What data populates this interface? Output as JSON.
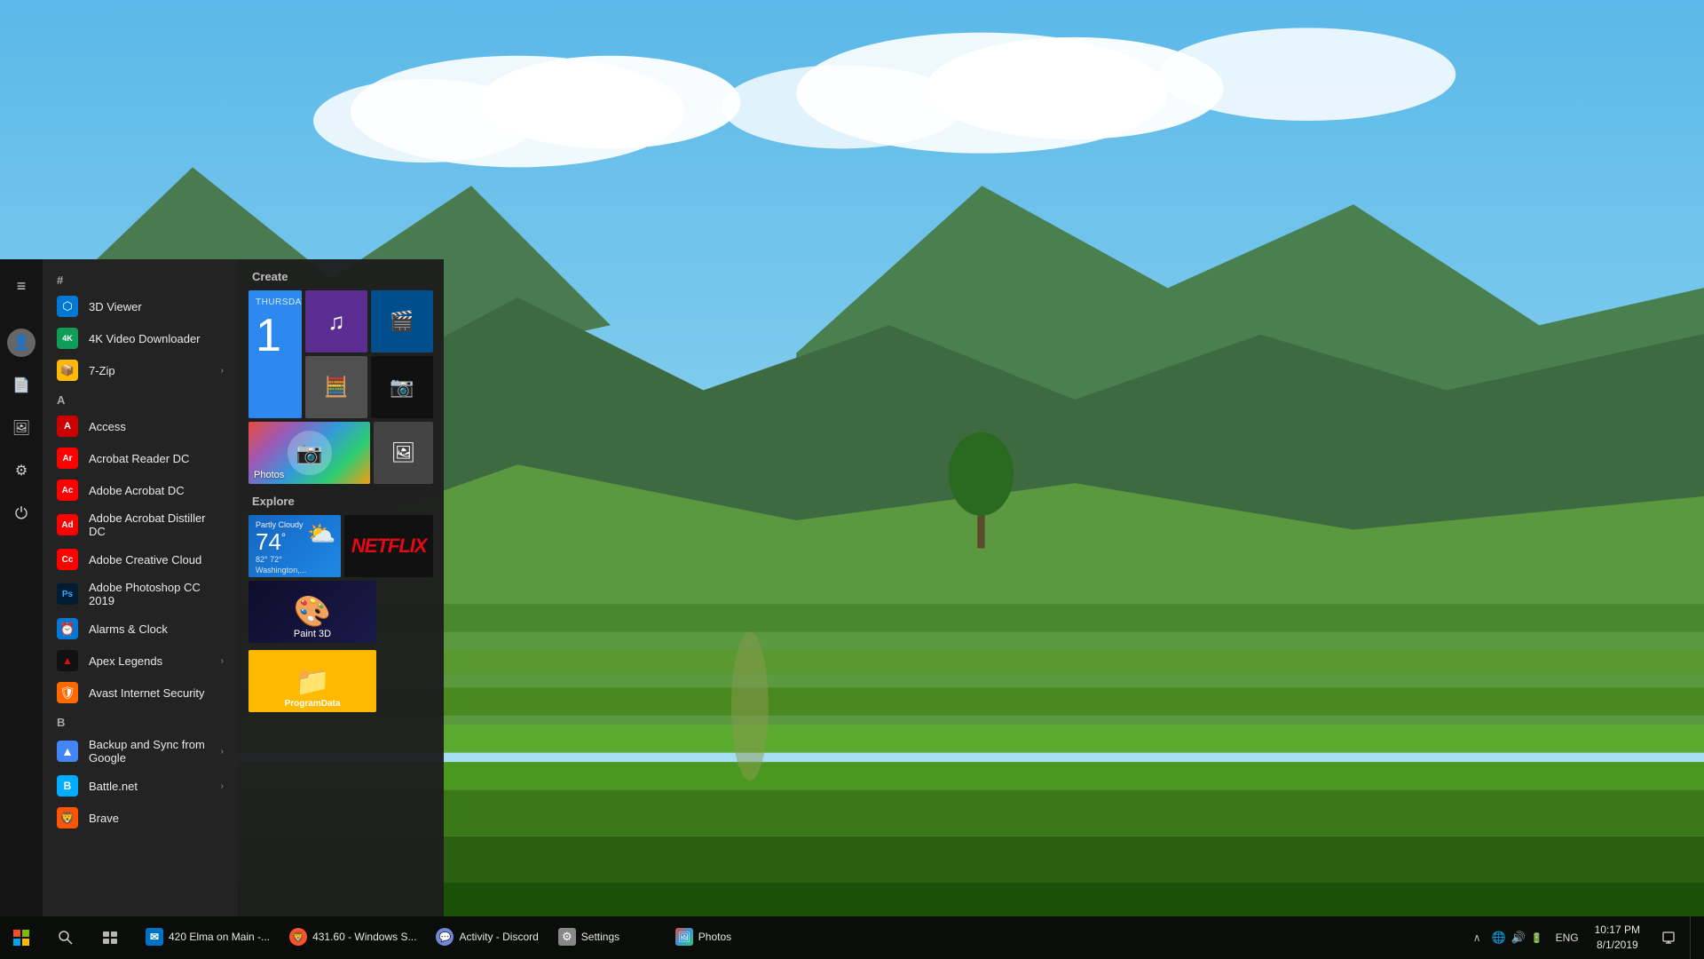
{
  "desktop": {
    "wallpaper_description": "Mountain valley landscape with green terraced fields"
  },
  "startmenu": {
    "sections": {
      "hash": "#",
      "a": "A",
      "b": "B"
    },
    "tiles_sections": {
      "create_label": "Create",
      "explore_label": "Explore"
    },
    "apps": [
      {
        "id": "3d-viewer",
        "label": "3D Viewer",
        "icon_type": "3d",
        "icon_char": "⬡",
        "has_chevron": false
      },
      {
        "id": "4k-video",
        "label": "4K Video Downloader",
        "icon_type": "4k",
        "icon_char": "4K",
        "has_chevron": false
      },
      {
        "id": "7-zip",
        "label": "7-Zip",
        "icon_type": "zip",
        "icon_char": "📦",
        "has_chevron": true
      },
      {
        "id": "access",
        "label": "Access",
        "icon_type": "access",
        "icon_char": "A",
        "has_chevron": false
      },
      {
        "id": "acrobat-reader",
        "label": "Acrobat Reader DC",
        "icon_type": "acrobat",
        "icon_char": "A",
        "has_chevron": false
      },
      {
        "id": "adobe-acrobat",
        "label": "Adobe Acrobat DC",
        "icon_type": "acrobat",
        "icon_char": "Ac",
        "has_chevron": false
      },
      {
        "id": "adobe-acrobat-distiller",
        "label": "Adobe Acrobat Distiller DC",
        "icon_type": "acrobat",
        "icon_char": "Ad",
        "has_chevron": false
      },
      {
        "id": "adobe-cc",
        "label": "Adobe Creative Cloud",
        "icon_type": "cc",
        "icon_char": "Cc",
        "has_chevron": false
      },
      {
        "id": "adobe-ps",
        "label": "Adobe Photoshop CC 2019",
        "icon_type": "ps",
        "icon_char": "Ps",
        "has_chevron": false
      },
      {
        "id": "alarms",
        "label": "Alarms & Clock",
        "icon_type": "alarm",
        "icon_char": "⏰",
        "has_chevron": false
      },
      {
        "id": "apex",
        "label": "Apex Legends",
        "icon_type": "apex",
        "icon_char": "▲",
        "has_chevron": true
      },
      {
        "id": "avast",
        "label": "Avast Internet Security",
        "icon_type": "avast",
        "icon_char": "🛡",
        "has_chevron": false
      },
      {
        "id": "backup-sync",
        "label": "Backup and Sync from Google",
        "icon_type": "backup",
        "icon_char": "▲",
        "has_chevron": true
      },
      {
        "id": "battle-net",
        "label": "Battle.net",
        "icon_type": "battle",
        "icon_char": "⚔",
        "has_chevron": true
      },
      {
        "id": "brave",
        "label": "Brave",
        "icon_type": "brave",
        "icon_char": "🦁",
        "has_chevron": false
      }
    ],
    "tiles": {
      "create": [
        {
          "id": "calendar",
          "type": "calendar",
          "size": "tall",
          "day": "Thursday",
          "date": "1"
        },
        {
          "id": "groove",
          "type": "media",
          "size": "sm",
          "icon": "♫",
          "color": "#5C2D91"
        },
        {
          "id": "movies",
          "type": "video",
          "size": "sm",
          "icon": "🎬",
          "color": "#004E8C"
        },
        {
          "id": "calculator",
          "type": "calc",
          "size": "sm",
          "icon": "🧮",
          "color": "#555"
        },
        {
          "id": "camera",
          "type": "camera",
          "size": "sm",
          "icon": "📷",
          "color": "#111"
        },
        {
          "id": "photos",
          "type": "photos",
          "size": "wide",
          "label": "Photos"
        },
        {
          "id": "photos-sm",
          "type": "photos-sm",
          "size": "sm",
          "icon": "🖼"
        }
      ],
      "explore": [
        {
          "id": "weather",
          "type": "weather",
          "size": "wide",
          "condition": "Partly Cloudy",
          "temp": "74",
          "high": "82°",
          "low": "72°",
          "location": "Washington,..."
        },
        {
          "id": "netflix",
          "type": "netflix",
          "size": "wide",
          "label": "Netflix",
          "text": "NETFLIX"
        },
        {
          "id": "paint3d",
          "type": "paint3d",
          "size": "wide",
          "label": "Paint 3D"
        }
      ],
      "programdata": [
        {
          "id": "programdata",
          "type": "folder",
          "size": "wide",
          "label": "ProgramData"
        }
      ]
    }
  },
  "taskbar": {
    "start_label": "Start",
    "search_label": "Search",
    "taskview_label": "Task View",
    "apps": [
      {
        "id": "outlook",
        "label": "420 Elma on Main -...",
        "icon": "✉",
        "icon_color": "#0072C6",
        "active": false
      },
      {
        "id": "brave",
        "label": "431.60 - Windows S...",
        "icon": "🦁",
        "icon_color": "#FB542B",
        "active": false
      },
      {
        "id": "discord-activity",
        "label": "Activity - Discord",
        "icon": "💬",
        "icon_color": "#7289DA",
        "active": false
      },
      {
        "id": "settings",
        "label": "Settings",
        "icon": "⚙",
        "icon_color": "#888",
        "active": false
      },
      {
        "id": "photos-tb",
        "label": "Photos",
        "icon": "🖼",
        "icon_color": "#444",
        "active": false
      }
    ],
    "systray": {
      "chevron": "^",
      "network": "🌐",
      "volume": "🔊",
      "battery": "🔋",
      "keyboard": "⌨"
    },
    "clock": {
      "time": "10:17 PM",
      "date": "8/1/2019"
    },
    "lang": "ENG",
    "notification_icon": "🔔",
    "show_desktop": ""
  },
  "nav_icons": {
    "hamburger": "≡",
    "user": "👤",
    "documents": "📄",
    "pictures": "🖼",
    "settings": "⚙",
    "power": "⏻",
    "hashtag": "#"
  }
}
